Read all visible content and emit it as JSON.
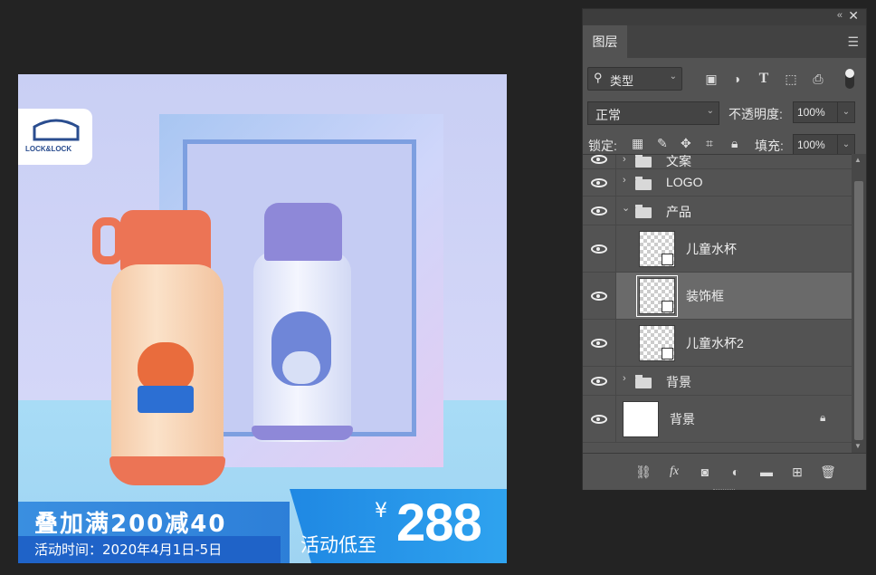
{
  "canvas": {
    "logo_text": "LOCK&LOCK",
    "banner": {
      "title": "叠加满200减40",
      "date": "活动时间：2020年4月1日-5日",
      "cta": "活动低至",
      "currency": "¥",
      "price": "288"
    }
  },
  "panel": {
    "tab": "图层",
    "filter": {
      "label": "类型"
    },
    "blend_mode": "正常",
    "opacity_label": "不透明度:",
    "opacity_value": "100%",
    "lock_label": "锁定:",
    "fill_label": "填充:",
    "fill_value": "100%",
    "layers": [
      {
        "name": "文案",
        "kind": "group",
        "collapsed": true
      },
      {
        "name": "LOGO",
        "kind": "group",
        "collapsed": true
      },
      {
        "name": "产品",
        "kind": "group",
        "collapsed": false
      },
      {
        "name": "儿童水杯",
        "kind": "smart-object"
      },
      {
        "name": "装饰框",
        "kind": "smart-object",
        "selected": true
      },
      {
        "name": "儿童水杯2",
        "kind": "smart-object"
      },
      {
        "name": "背景",
        "kind": "group",
        "collapsed": true
      },
      {
        "name": "背景",
        "kind": "background",
        "locked": true
      }
    ]
  }
}
